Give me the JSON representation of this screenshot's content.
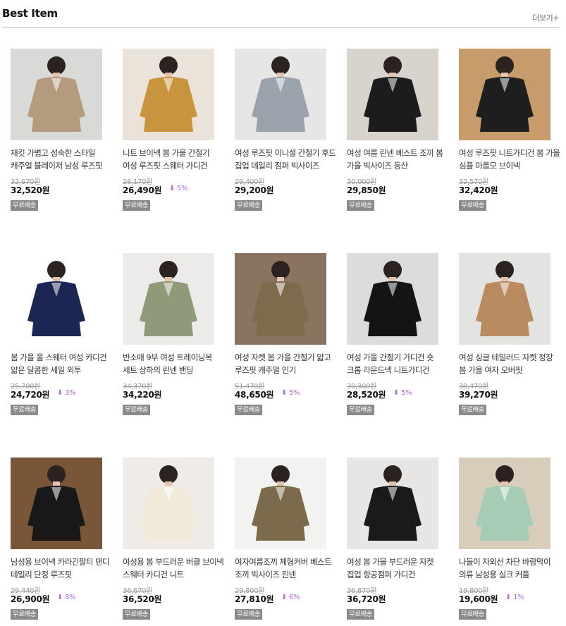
{
  "header": {
    "title": "Best Item",
    "more_label": "더보기+"
  },
  "products": [
    {
      "name": "재킷 가볍고 성숙한 스타일 캐주얼 블레이저 남성 루즈핏",
      "original_price": "32,670원",
      "price": "32,520원",
      "discount": "",
      "badge": "무료배송",
      "bg": "#d9dad8",
      "cloth": "#b49b7e"
    },
    {
      "name": "니트 브이넥 봄 가을 간절기 여성 루즈핏 스웨터 가디건",
      "original_price": "28,170원",
      "price": "26,490원",
      "discount": "5%",
      "badge": "무료배송",
      "bg": "#e9e3da",
      "cloth": "#c8953e"
    },
    {
      "name": "여성 루즈핏 이니셜 간절기 후드 집업 데일리 점퍼 빅사이즈",
      "original_price": "29,400원",
      "price": "29,200원",
      "discount": "",
      "badge": "무료배송",
      "bg": "#e6e6e6",
      "cloth": "#9aa3ab"
    },
    {
      "name": "여성 여름 린넨 베스트 조끼 봄 가을 빅사이즈 등산",
      "original_price": "30,000원",
      "price": "29,850원",
      "discount": "",
      "badge": "무료배송",
      "bg": "#d8d3cc",
      "cloth": "#1c1c1c"
    },
    {
      "name": "여성 루즈핏 니트가디건 봄 가을 심플 마름모 브이넥",
      "original_price": "32,570원",
      "price": "32,420원",
      "discount": "",
      "badge": "무료배송",
      "bg": "#c79c6a",
      "cloth": "#1e1e1e"
    },
    {
      "name": "봄 가을 울 스웨터 여성 카디건 얇은 달콤한 세일 외투",
      "original_price": "25,700원",
      "price": "24,720원",
      "discount": "3%",
      "badge": "무료배송",
      "bg": "#ffffff",
      "cloth": "#1c2653"
    },
    {
      "name": "반소매 9부 여성 트레이닝복 세트 상하의 린넨 밴딩",
      "original_price": "34,370원",
      "price": "34,220원",
      "discount": "",
      "badge": "무료배송",
      "bg": "#ecebea",
      "cloth": "#8e9a78"
    },
    {
      "name": "여성 자켓 봄 가을 간절기 얇고 루즈핏 캐주얼 인기",
      "original_price": "51,470원",
      "price": "48,650원",
      "discount": "5%",
      "badge": "무료배송",
      "bg": "#8a7460",
      "cloth": "#7e6a4d"
    },
    {
      "name": "여성 가을 간절기 가디건 숏 크롭 라운드넥 니트가디건",
      "original_price": "30,300원",
      "price": "28,520원",
      "discount": "5%",
      "badge": "무료배송",
      "bg": "#dcdcdc",
      "cloth": "#141414"
    },
    {
      "name": "여성 싱글 테일러드 자켓 정장 봄 가을 여자 오버핏",
      "original_price": "39,470원",
      "price": "39,270원",
      "discount": "",
      "badge": "무료배송",
      "bg": "#e3e3e1",
      "cloth": "#b88b60"
    },
    {
      "name": "남성용 브이넥 카라긴팔티 댄디 데일리 단정 루즈핏",
      "original_price": "29,440원",
      "price": "26,900원",
      "discount": "8%",
      "badge": "무료배송",
      "bg": "#7a5638",
      "cloth": "#181818"
    },
    {
      "name": "여성용 봄 부드러운 버클 브이넥 스웨터 카디건 니트",
      "original_price": "36,670원",
      "price": "36,520원",
      "discount": "",
      "badge": "무료배송",
      "bg": "#efece8",
      "cloth": "#f1ead8"
    },
    {
      "name": "여자여름조끼 체형커버 베스트 조끼 빅사이즈 린넨",
      "original_price": "29,800원",
      "price": "27,810원",
      "discount": "6%",
      "badge": "무료배송",
      "bg": "#f2f2f0",
      "cloth": "#7c6a4d"
    },
    {
      "name": "여성 봄 가을 부드러운 자켓 집업 향공점퍼 가디건",
      "original_price": "36,870원",
      "price": "36,720원",
      "discount": "",
      "badge": "무료배송",
      "bg": "#e8e6e4",
      "cloth": "#1a1a1a"
    },
    {
      "name": "나들이 자외선 차단 바람막이 의류 남성용 실크 커플",
      "original_price": "19,800원",
      "price": "19,600원",
      "discount": "1%",
      "badge": "무료배송",
      "bg": "#d8ccbb",
      "cloth": "#a7ccb5"
    }
  ]
}
